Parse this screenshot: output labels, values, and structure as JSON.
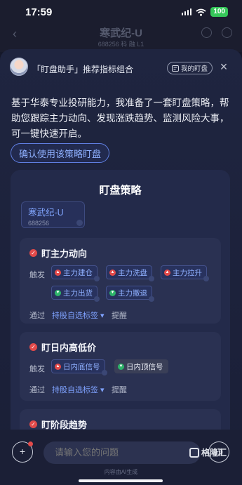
{
  "status_bar": {
    "time": "17:59",
    "battery": "100"
  },
  "underlying_header": {
    "title": "寒武纪-U",
    "subtitle": "688256  科 融 L1"
  },
  "panel": {
    "title": "「盯盘助手」推荐指标组合",
    "my_watch_label": "我的盯盘",
    "intro": "基于华泰专业投研能力，我准备了一套盯盘策略，帮助您跟踪主力动向、发现涨跌趋势、监测风险大事，可一键快速开启。",
    "confirm_button": "确认使用该策略盯盘"
  },
  "strategy": {
    "title": "盯盘策略",
    "stock": {
      "name": "寒武纪-U",
      "code": "688256"
    },
    "sections": [
      {
        "title": "盯主力动向",
        "trigger_label": "触发",
        "tags": [
          {
            "label": "主力建仓",
            "color": "red"
          },
          {
            "label": "主力洗盘",
            "color": "red"
          },
          {
            "label": "主力拉升",
            "color": "red"
          },
          {
            "label": "主力出货",
            "color": "green"
          },
          {
            "label": "主力撤退",
            "color": "green"
          }
        ],
        "via_label": "通过",
        "via_value": "持股自选标签",
        "remind_label": "提醒"
      },
      {
        "title": "盯日内高低价",
        "trigger_label": "触发",
        "tags": [
          {
            "label": "日内底信号",
            "color": "red"
          },
          {
            "label": "日内顶信号",
            "color": "green"
          }
        ],
        "via_label": "通过",
        "via_value": "持股自选标签",
        "remind_label": "提醒"
      },
      {
        "title": "盯阶段趋势"
      }
    ]
  },
  "bottom": {
    "input_placeholder": "请输入您的问题",
    "ai_note": "内容由AI生成"
  },
  "watermark": "格隆汇",
  "colors": {
    "accent": "#8fb0ff",
    "up": "#e24a4a",
    "down": "#2eb46a"
  }
}
